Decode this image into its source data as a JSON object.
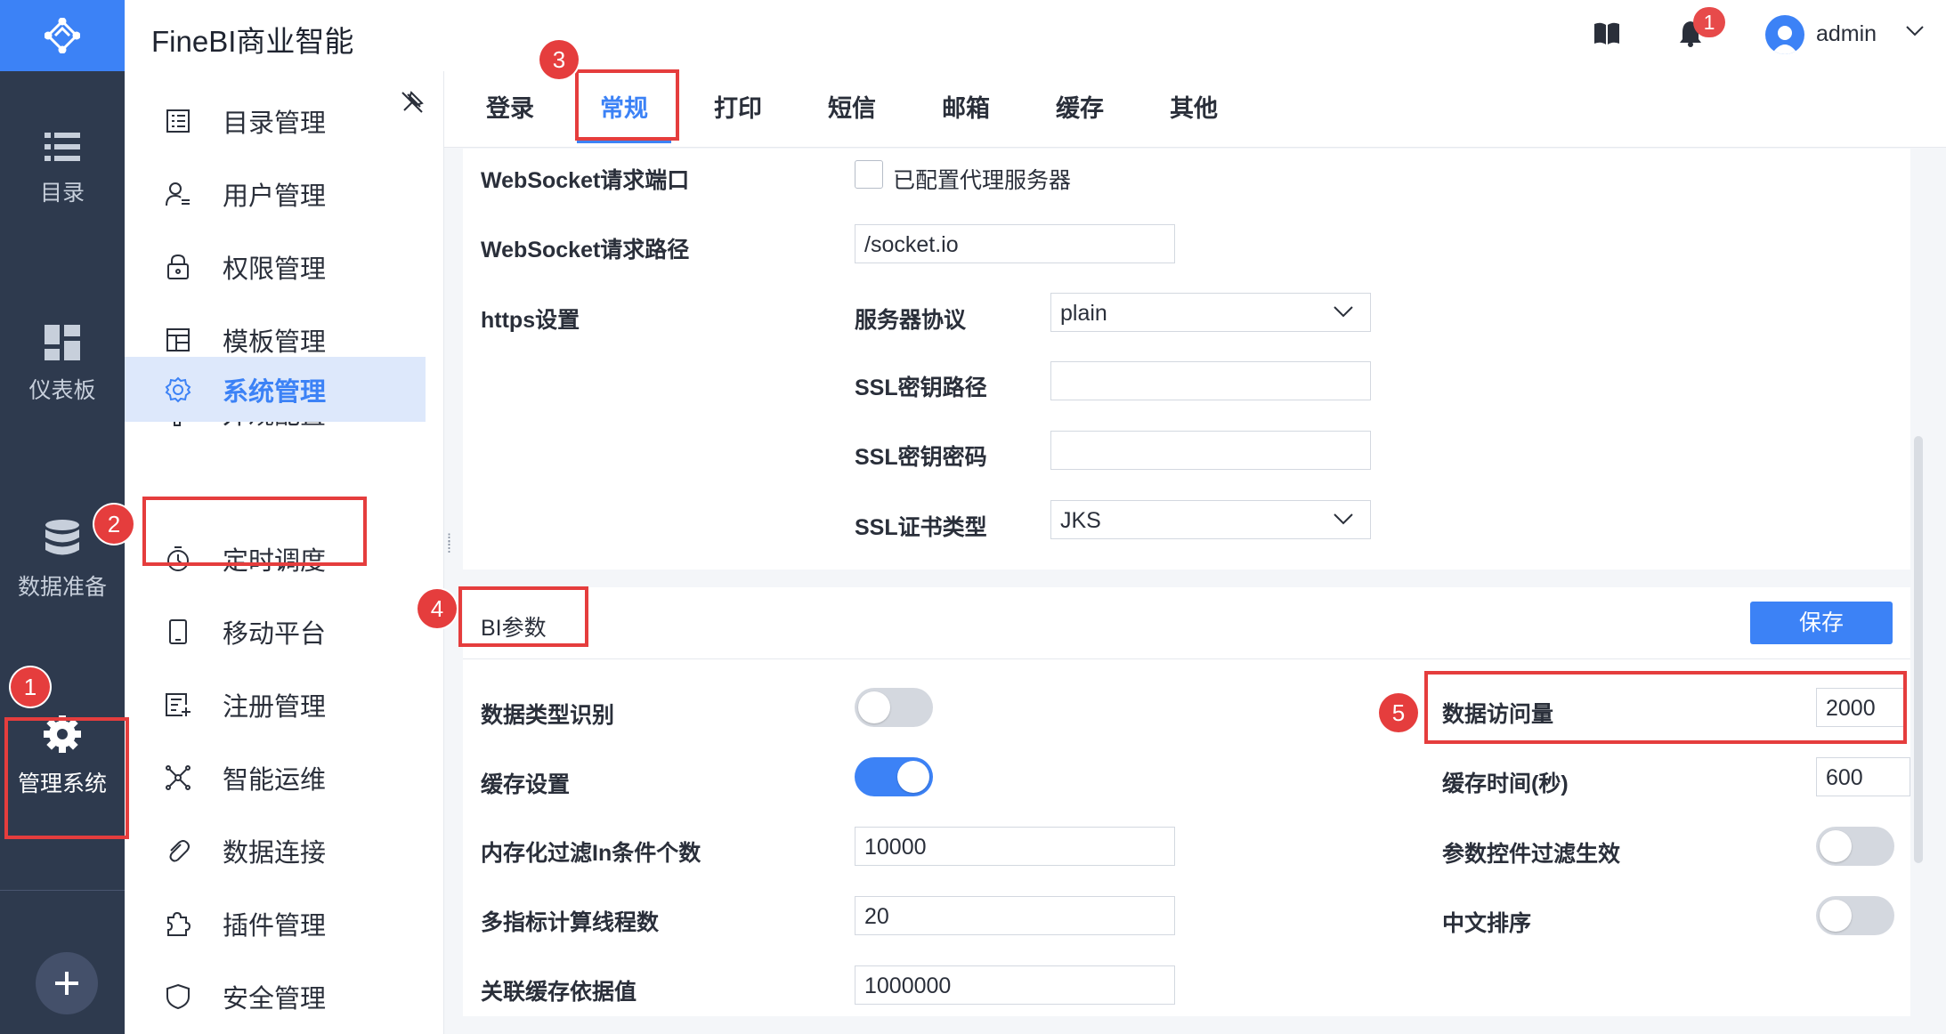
{
  "app": {
    "title": "FineBI商业智能"
  },
  "header": {
    "notification_count": "1",
    "username": "admin"
  },
  "rail": {
    "items": [
      {
        "label": "目录",
        "icon": "list-icon"
      },
      {
        "label": "仪表板",
        "icon": "dashboard-icon"
      },
      {
        "label": "数据准备",
        "icon": "database-icon"
      },
      {
        "label": "管理系统",
        "icon": "gear-icon"
      }
    ],
    "add_icon": "plus-icon"
  },
  "sidebar": {
    "items": [
      {
        "label": "目录管理",
        "icon": "catalog-icon"
      },
      {
        "label": "用户管理",
        "icon": "user-icon"
      },
      {
        "label": "权限管理",
        "icon": "lock-icon"
      },
      {
        "label": "模板管理",
        "icon": "template-icon"
      },
      {
        "label": "外观配置",
        "icon": "paint-roller-icon"
      },
      {
        "label": "系统管理",
        "icon": "gear-icon",
        "active": true
      },
      {
        "label": "定时调度",
        "icon": "timer-icon"
      },
      {
        "label": "移动平台",
        "icon": "mobile-icon"
      },
      {
        "label": "注册管理",
        "icon": "register-icon"
      },
      {
        "label": "智能运维",
        "icon": "network-icon"
      },
      {
        "label": "数据连接",
        "icon": "link-icon"
      },
      {
        "label": "插件管理",
        "icon": "puzzle-icon"
      },
      {
        "label": "安全管理",
        "icon": "shield-icon"
      }
    ]
  },
  "tabs": [
    {
      "label": "登录"
    },
    {
      "label": "常规",
      "active": true
    },
    {
      "label": "打印"
    },
    {
      "label": "短信"
    },
    {
      "label": "邮箱"
    },
    {
      "label": "缓存"
    },
    {
      "label": "其他"
    }
  ],
  "general": {
    "websocket_port_label": "WebSocket请求端口",
    "proxy_checkbox_label": "已配置代理服务器",
    "websocket_path_label": "WebSocket请求路径",
    "websocket_path_value": "/socket.io",
    "https_label": "https设置",
    "server_protocol_label": "服务器协议",
    "server_protocol_value": "plain",
    "ssl_key_path_label": "SSL密钥路径",
    "ssl_key_password_label": "SSL密钥密码",
    "ssl_cert_type_label": "SSL证书类型",
    "ssl_cert_type_value": "JKS"
  },
  "bi_params": {
    "section_title": "BI参数",
    "save_label": "保存",
    "data_type_detect_label": "数据类型识别",
    "data_type_detect_on": false,
    "cache_setting_label": "缓存设置",
    "cache_setting_on": true,
    "in_filter_count_label": "内存化过滤In条件个数",
    "in_filter_count_value": "10000",
    "thread_count_label": "多指标计算线程数",
    "thread_count_value": "20",
    "assoc_cache_label": "关联缓存依据值",
    "assoc_cache_value": "1000000",
    "data_access_label": "数据访问量",
    "data_access_value": "2000",
    "cache_time_label": "缓存时间(秒)",
    "cache_time_value": "600",
    "param_filter_label": "参数控件过滤生效",
    "param_filter_on": false,
    "chinese_sort_label": "中文排序",
    "chinese_sort_on": false
  },
  "annotations": [
    "1",
    "1",
    "2",
    "3",
    "4",
    "5"
  ],
  "colors": {
    "accent": "#3c82f6",
    "rail": "#2e3a4e",
    "annotation": "#e53d3d"
  }
}
